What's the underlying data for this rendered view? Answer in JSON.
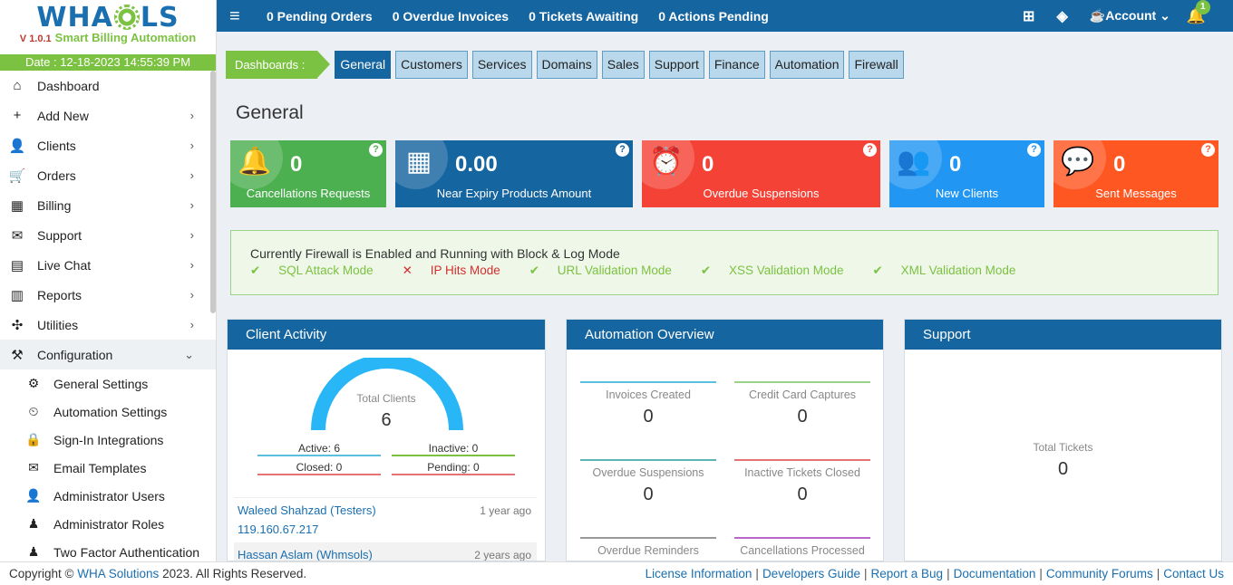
{
  "brand": {
    "logo_left": "WHA",
    "logo_right": "LS",
    "version": "V 1.0.1",
    "tagline": "Smart Billing Automation",
    "date": "Date : 12-18-2023 14:55:39 PM"
  },
  "topbar": {
    "pending_orders": "0 Pending Orders",
    "overdue_invoices": "0 Overdue Invoices",
    "tickets_awaiting": "0 Tickets Awaiting",
    "actions_pending": "0 Actions Pending",
    "account": "Account",
    "notifications": "1"
  },
  "sidebar": {
    "items": [
      {
        "label": "Dashboard",
        "icon": "home-icon"
      },
      {
        "label": "Add New",
        "icon": "plus-icon"
      },
      {
        "label": "Clients",
        "icon": "user-icon"
      },
      {
        "label": "Orders",
        "icon": "cart-icon"
      },
      {
        "label": "Billing",
        "icon": "calendar-icon"
      },
      {
        "label": "Support",
        "icon": "envelope-icon"
      },
      {
        "label": "Live Chat",
        "icon": "chat-icon"
      },
      {
        "label": "Reports",
        "icon": "report-icon"
      },
      {
        "label": "Utilities",
        "icon": "puzzle-icon"
      },
      {
        "label": "Configuration",
        "icon": "tools-icon"
      }
    ],
    "submenu": [
      {
        "label": "General Settings",
        "icon": "gear-icon"
      },
      {
        "label": "Automation Settings",
        "icon": "clock-icon"
      },
      {
        "label": "Sign-In Integrations",
        "icon": "lock-icon"
      },
      {
        "label": "Email Templates",
        "icon": "envelope-icon"
      },
      {
        "label": "Administrator Users",
        "icon": "user-icon"
      },
      {
        "label": "Administrator Roles",
        "icon": "user-tie-icon"
      },
      {
        "label": "Two Factor Authentication",
        "icon": "shield-icon"
      }
    ]
  },
  "tabs": {
    "lead": "Dashboards :",
    "items": [
      "General",
      "Customers",
      "Services",
      "Domains",
      "Sales",
      "Support",
      "Finance",
      "Automation",
      "Firewall"
    ]
  },
  "page_title": "General",
  "cards": [
    {
      "value": "0",
      "label": "Cancellations Requests",
      "color": "#4caf50",
      "icon": "bell-x-icon"
    },
    {
      "value": "0.00",
      "label": "Near Expiry Products Amount",
      "color": "#1565a0",
      "icon": "calendar-icon"
    },
    {
      "value": "0",
      "label": "Overdue Suspensions",
      "color": "#f44336",
      "icon": "alarm-icon"
    },
    {
      "value": "0",
      "label": "New Clients",
      "color": "#2196f3",
      "icon": "users-icon"
    },
    {
      "value": "0",
      "label": "Sent Messages",
      "color": "#ff5722",
      "icon": "message-icon"
    }
  ],
  "firewall": {
    "status": "Currently Firewall is Enabled and Running with Block & Log Mode",
    "modes": [
      {
        "label": "SQL Attack Mode",
        "ok": true
      },
      {
        "label": "IP Hits Mode",
        "ok": false
      },
      {
        "label": "URL Validation Mode",
        "ok": true
      },
      {
        "label": "XSS Validation Mode",
        "ok": true
      },
      {
        "label": "XML Validation Mode",
        "ok": true
      }
    ]
  },
  "client_activity": {
    "title": "Client Activity",
    "total_label": "Total Clients",
    "total": "6",
    "active": "Active: 6",
    "inactive": "Inactive: 0",
    "closed": "Closed: 0",
    "pending": "Pending: 0",
    "activity": [
      {
        "name": "Waleed Shahzad (Testers)",
        "time": "1 year ago",
        "ip": "119.160.67.217"
      },
      {
        "name": "Hassan Aslam (Whmsols)",
        "time": "2 years ago",
        "ip": ""
      }
    ]
  },
  "automation": {
    "title": "Automation Overview",
    "items": [
      {
        "label": "Invoices Created",
        "value": "0",
        "color": "#5bc0de"
      },
      {
        "label": "Credit Card Captures",
        "value": "0",
        "color": "#9bd38a"
      },
      {
        "label": "Overdue Suspensions",
        "value": "0",
        "color": "#5bb5b5"
      },
      {
        "label": "Inactive Tickets Closed",
        "value": "0",
        "color": "#e57373"
      },
      {
        "label": "Overdue Reminders",
        "value": "",
        "color": "#999999"
      },
      {
        "label": "Cancellations Processed",
        "value": "",
        "color": "#ba68c8"
      }
    ]
  },
  "support": {
    "title": "Support",
    "total_label": "Total Tickets",
    "total": "0"
  },
  "footer": {
    "copy_prefix": "Copyright ©",
    "company": "WHA Solutions",
    "copy_suffix": "2023. All Rights Reserved.",
    "links": [
      "License Information",
      "Developers Guide",
      "Report a Bug",
      "Documentation",
      "Community Forums",
      "Contact Us"
    ]
  }
}
